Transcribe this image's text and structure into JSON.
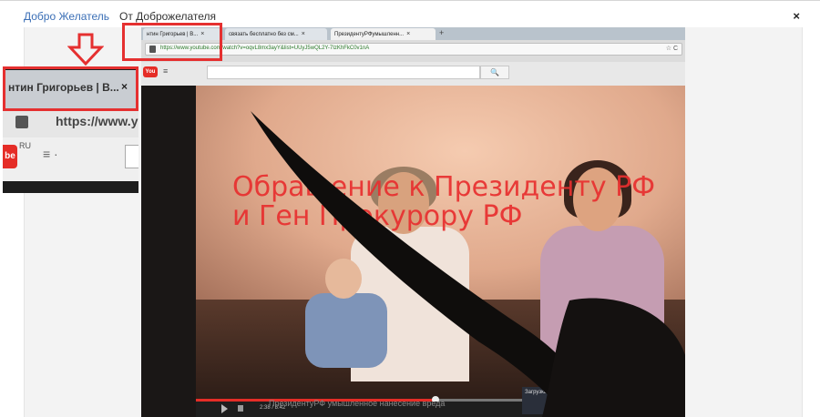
{
  "topbar": {
    "link_1": "Добро Желатель",
    "link_2": "От Доброжелателя",
    "close_label": "×"
  },
  "browser": {
    "tabs": [
      {
        "label": "нтин Григорьев | В..."
      },
      {
        "label": "связать бесплатно без см..."
      },
      {
        "label": "ПрезидентуРФумышленн..."
      }
    ],
    "tab_close": "×",
    "new_tab": "+",
    "url": "https://www.youtube.com/watch?v=oqvL8mx3ayY&list=UUyJ5wQL2Y-7IzKhFkC0v1nA",
    "url_buttons": "☆ C"
  },
  "youtube": {
    "logo": "You",
    "menu": "≡",
    "search_button": "🔍"
  },
  "video": {
    "overlay_line_1": "Обращение к Президенту РФ",
    "overlay_line_2": "и Ген Прокурору РФ",
    "progress": 0.49,
    "time": "2:38 / 5:42",
    "caption": "ПрезидентуРФ умышленное нанесение вреда",
    "promo": "Загрузка с канала"
  },
  "inset": {
    "tab_text": "нтин Григорьев | В...",
    "tab_close": "×",
    "url_text": "https://www.you",
    "yt_logo": "be",
    "yt_region": "RU",
    "yt_menu": "≡ ·"
  },
  "colors": {
    "link": "#3b6fb6",
    "highlight_box": "#e53030",
    "overlay_text": "#e82f2f",
    "youtube_red": "#e52d27"
  }
}
